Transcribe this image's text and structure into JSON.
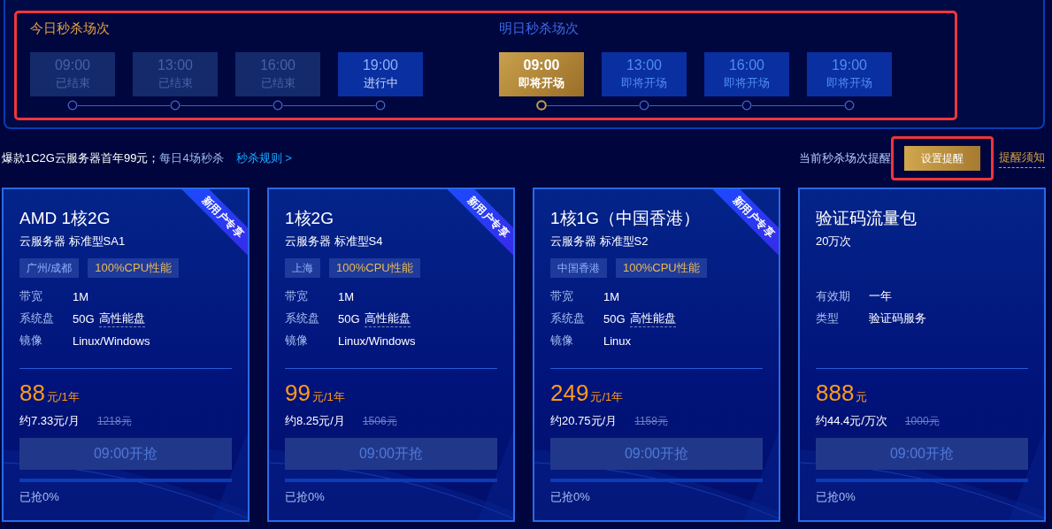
{
  "schedule": {
    "today": {
      "title": "今日秒杀场次",
      "sessions": [
        {
          "time": "09:00",
          "status": "已结束",
          "kind": "ended",
          "selected": false
        },
        {
          "time": "13:00",
          "status": "已结束",
          "kind": "ended",
          "selected": false
        },
        {
          "time": "16:00",
          "status": "已结束",
          "kind": "ended",
          "selected": false
        },
        {
          "time": "19:00",
          "status": "进行中",
          "kind": "live",
          "selected": false
        }
      ]
    },
    "tomorrow": {
      "title": "明日秒杀场次",
      "sessions": [
        {
          "time": "09:00",
          "status": "即将开场",
          "kind": "upcoming",
          "selected": true
        },
        {
          "time": "13:00",
          "status": "即将开场",
          "kind": "upcoming",
          "selected": false
        },
        {
          "time": "16:00",
          "status": "即将开场",
          "kind": "upcoming",
          "selected": false
        },
        {
          "time": "19:00",
          "status": "即将开场",
          "kind": "upcoming",
          "selected": false
        }
      ]
    }
  },
  "promo": {
    "headline": "爆款1C2G云服务器首年99元；",
    "subline": "每日4场秒杀",
    "rules_link": "秒杀规则 >"
  },
  "reminder": {
    "label": "当前秒杀场次提醒",
    "button": "设置提醒",
    "notice_link": "提醒须知"
  },
  "products": [
    {
      "title": "AMD 1核2G",
      "subtitle": "云服务器 标准型SA1",
      "ribbon": "新用户专享",
      "tags": [
        {
          "text": "广州/成都",
          "kind": "region"
        },
        {
          "text": "100%CPU性能",
          "kind": "perf"
        }
      ],
      "specs": [
        {
          "label": "带宽",
          "value": "1M"
        },
        {
          "label": "系统盘",
          "value": "50G",
          "tip": "高性能盘"
        },
        {
          "label": "镜像",
          "value": "Linux/Windows"
        }
      ],
      "price": "88",
      "unit": "元/1年",
      "monthly": "约7.33元/月",
      "original": "1218元",
      "button": "09:00开抢",
      "level": 0,
      "sold": "已抢0%"
    },
    {
      "title": "1核2G",
      "subtitle": "云服务器 标准型S4",
      "ribbon": "新用户专享",
      "tags": [
        {
          "text": "上海",
          "kind": "region"
        },
        {
          "text": "100%CPU性能",
          "kind": "perf"
        }
      ],
      "specs": [
        {
          "label": "带宽",
          "value": "1M"
        },
        {
          "label": "系统盘",
          "value": "50G",
          "tip": "高性能盘"
        },
        {
          "label": "镜像",
          "value": "Linux/Windows"
        }
      ],
      "price": "99",
      "unit": "元/1年",
      "monthly": "约8.25元/月",
      "original": "1506元",
      "button": "09:00开抢",
      "level": 0,
      "sold": "已抢0%"
    },
    {
      "title": "1核1G（中国香港）",
      "subtitle": "云服务器 标准型S2",
      "ribbon": "新用户专享",
      "tags": [
        {
          "text": "中国香港",
          "kind": "region"
        },
        {
          "text": "100%CPU性能",
          "kind": "perf"
        }
      ],
      "specs": [
        {
          "label": "带宽",
          "value": "1M"
        },
        {
          "label": "系统盘",
          "value": "50G",
          "tip": "高性能盘"
        },
        {
          "label": "镜像",
          "value": "Linux"
        }
      ],
      "price": "249",
      "unit": "元/1年",
      "monthly": "约20.75元/月",
      "original": "1158元",
      "button": "09:00开抢",
      "level": 0,
      "sold": "已抢0%"
    },
    {
      "title": "验证码流量包",
      "subtitle": "20万次",
      "specs": [
        {
          "label": "有效期",
          "value": "一年"
        },
        {
          "label": "类型",
          "value": "验证码服务"
        }
      ],
      "price": "888",
      "unit": "元",
      "monthly": "约44.4元/万次",
      "original": "1000元",
      "button": "09:00开抢",
      "level": 0,
      "sold": "已抢0%"
    }
  ]
}
